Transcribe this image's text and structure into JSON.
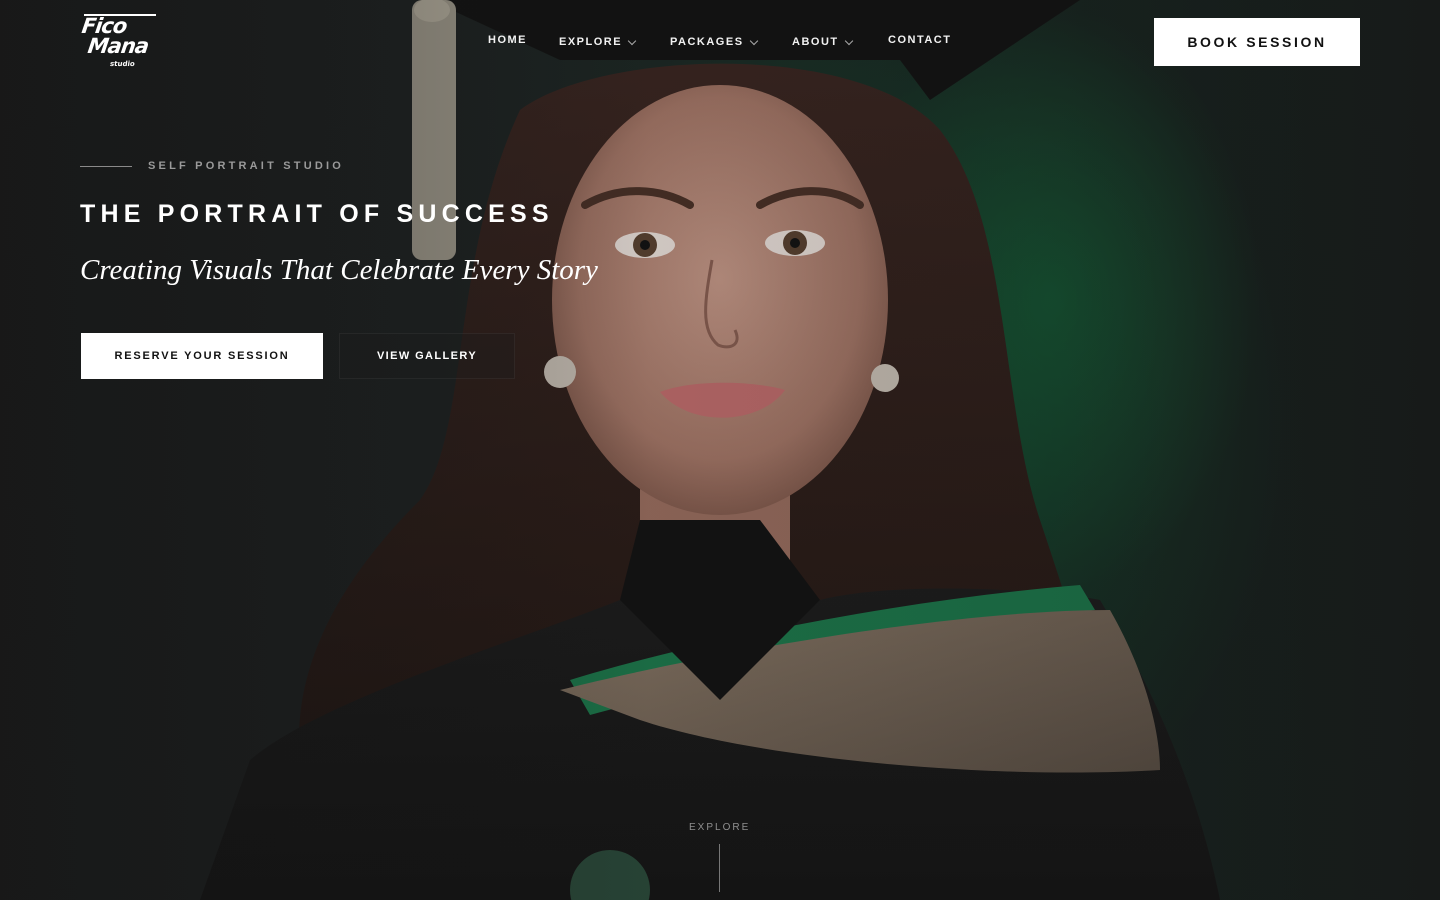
{
  "brand": {
    "logo_line1": "Fico",
    "logo_line2": "Mana",
    "logo_line3": "studio"
  },
  "nav": {
    "items": [
      {
        "label": "HOME",
        "has_dropdown": false
      },
      {
        "label": "EXPLORE",
        "has_dropdown": true
      },
      {
        "label": "PACKAGES",
        "has_dropdown": true
      },
      {
        "label": "ABOUT",
        "has_dropdown": true
      },
      {
        "label": "CONTACT",
        "has_dropdown": false
      }
    ],
    "cta_label": "BOOK SESSION"
  },
  "hero": {
    "eyebrow": "SELF PORTRAIT STUDIO",
    "title": "THE PORTRAIT OF SUCCESS",
    "subtitle": "Creating Visuals That Celebrate Every Story",
    "primary_button": "RESERVE YOUR SESSION",
    "secondary_button": "VIEW GALLERY",
    "image_icon": "graduate-portrait-photo"
  },
  "scroll": {
    "label": "EXPLORE"
  },
  "colors": {
    "background": "#1d1f1f",
    "accent_green": "#1a6a40",
    "button_bg": "#ffffff",
    "button_text": "#111111"
  }
}
